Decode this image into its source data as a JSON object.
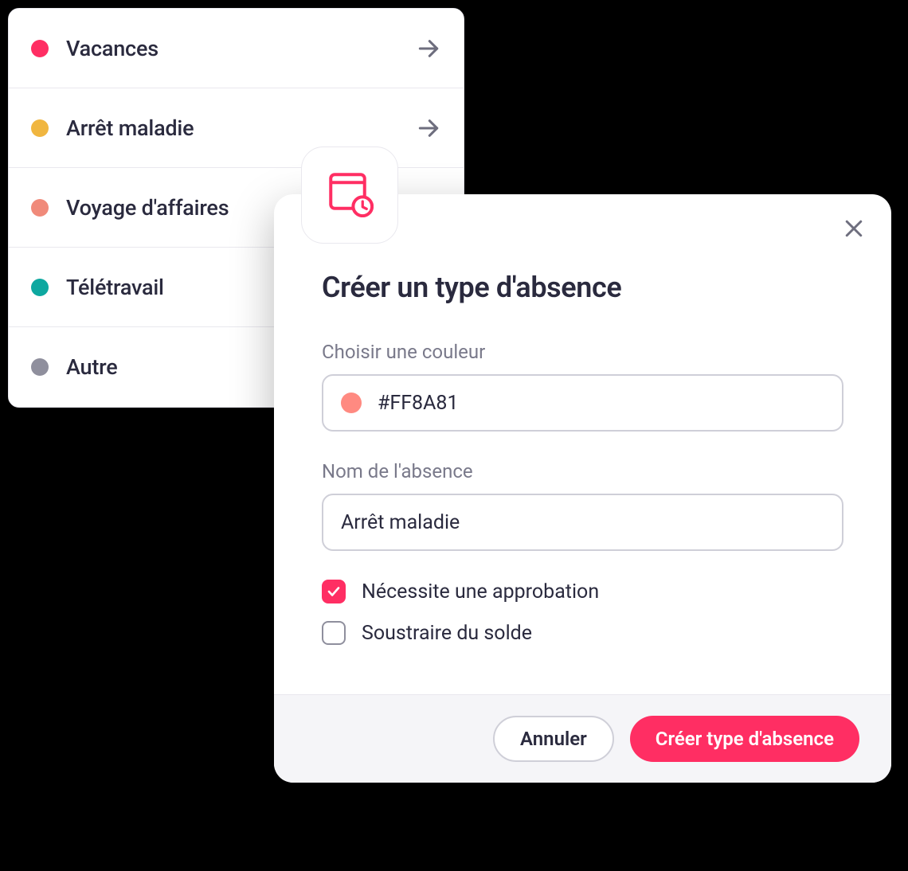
{
  "colors": {
    "accent": "#ff2e63"
  },
  "list": {
    "items": [
      {
        "label": "Vacances",
        "color": "#ff2e63",
        "has_arrow": true
      },
      {
        "label": "Arrêt maladie",
        "color": "#f0b640",
        "has_arrow": true
      },
      {
        "label": "Voyage d'affaires",
        "color": "#f08a7a",
        "has_arrow": false
      },
      {
        "label": "Télétravail",
        "color": "#0ea8a0",
        "has_arrow": false
      },
      {
        "label": "Autre",
        "color": "#8f8f9d",
        "has_arrow": false
      }
    ]
  },
  "modal": {
    "title": "Créer un type d'absence",
    "color_field": {
      "label": "Choisir une couleur",
      "value": "#FF8A81",
      "swatch": "#ff8a81"
    },
    "name_field": {
      "label": "Nom de l'absence",
      "value": "Arrêt maladie"
    },
    "checks": [
      {
        "label": "Nécessite une approbation",
        "checked": true
      },
      {
        "label": "Soustraire du solde",
        "checked": false
      }
    ],
    "footer": {
      "cancel": "Annuler",
      "submit": "Créer type d'absence"
    }
  }
}
